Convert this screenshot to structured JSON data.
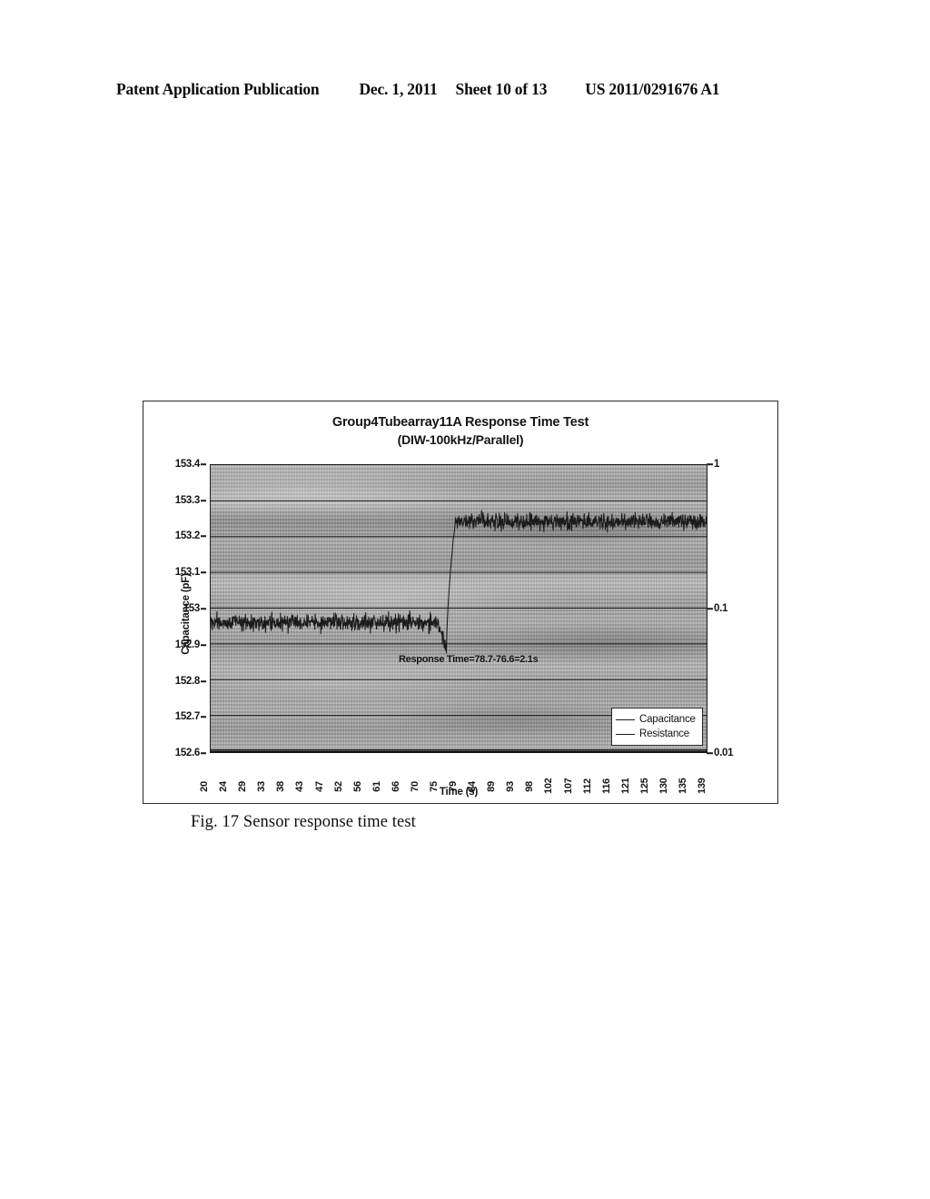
{
  "header": {
    "publication": "Patent Application Publication",
    "date": "Dec. 1, 2011",
    "sheet": "Sheet 10 of 13",
    "document_number": "US 2011/0291676 A1"
  },
  "figure": {
    "caption": "Fig. 17 Sensor response time test"
  },
  "chart_data": {
    "type": "line",
    "title": "Group4Tubearray11A Response Time Test",
    "subtitle": "(DIW-100kHz/Parallel)",
    "xlabel": "Time (s)",
    "ylabel": "Capacitance (pF)",
    "ylabel_right": "",
    "grid": true,
    "legend_position": "bottom-right",
    "xlim": [
      20,
      139
    ],
    "ylim": [
      152.6,
      153.4
    ],
    "y_ticks": [
      "153.4",
      "153.3",
      "153.2",
      "153.1",
      "153",
      "152.9",
      "152.8",
      "152.7",
      "152.6"
    ],
    "y2_scale": "log",
    "y2lim": [
      0.01,
      1
    ],
    "y2_ticks": [
      "1",
      "0.1",
      "0.01"
    ],
    "x_ticks": [
      "20",
      "24",
      "29",
      "33",
      "38",
      "43",
      "47",
      "52",
      "56",
      "61",
      "66",
      "70",
      "75",
      "79",
      "84",
      "89",
      "93",
      "98",
      "102",
      "107",
      "112",
      "116",
      "121",
      "125",
      "130",
      "135",
      "139"
    ],
    "annotations": [
      {
        "text": "Response Time=78.7-76.6=2.1s",
        "x": 76.0,
        "y": 152.83
      }
    ],
    "legend": [
      {
        "name": "Capacitance",
        "color": "#1b1b1b"
      },
      {
        "name": "Resistance",
        "color": "#1b1b1b"
      }
    ],
    "series": [
      {
        "name": "Capacitance",
        "color": "#1b1b1b",
        "units": "pF",
        "axis": "left",
        "description": "Noisy baseline near 152.96 pF until ~76.6 s, brief dip to ~152.88 pF, sharp rise between 76.6 s and 78.7 s, then noisy plateau near 153.24 pF.",
        "baseline_level": 152.96,
        "baseline_noise": 0.035,
        "dip_level": 152.885,
        "plateau_level": 153.242,
        "plateau_noise": 0.032,
        "step_start_s": 76.6,
        "step_end_s": 78.7,
        "response_time_s": 2.1
      },
      {
        "name": "Resistance",
        "color": "#1b1b1b",
        "units": "",
        "axis": "right",
        "description": "Plotted on the logarithmic right axis; trace lies at the bottom of the plot area and is not visibly separated from the axis line.",
        "level": 0.01
      }
    ]
  }
}
